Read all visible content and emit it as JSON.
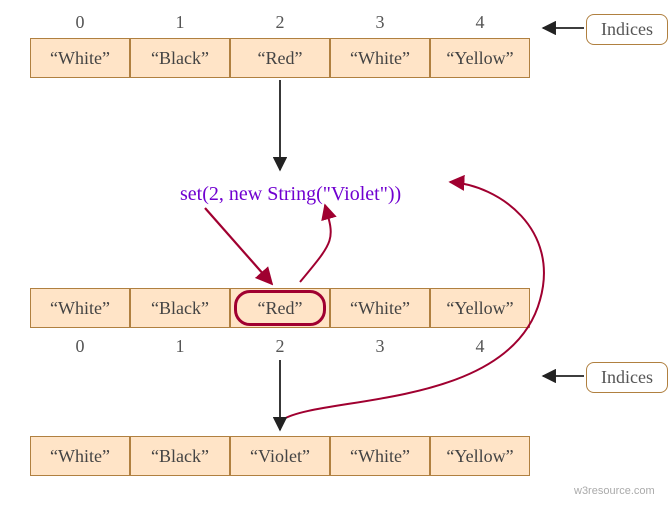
{
  "indices": {
    "0": "0",
    "1": "1",
    "2": "2",
    "3": "3",
    "4": "4"
  },
  "labels": {
    "indices": "Indices",
    "code": "set(2, new String(\"Violet\"))",
    "watermark": "w3resource.com"
  },
  "array1": {
    "0": "“White”",
    "1": "“Black”",
    "2": "“Red”",
    "3": "“White”",
    "4": "“Yellow”"
  },
  "array2": {
    "0": "“White”",
    "1": "“Black”",
    "2": "“Red”",
    "3": "“White”",
    "4": "“Yellow”"
  },
  "array3": {
    "0": "“White”",
    "1": "“Black”",
    "2": "“Violet”",
    "3": "“White”",
    "4": "“Yellow”"
  }
}
